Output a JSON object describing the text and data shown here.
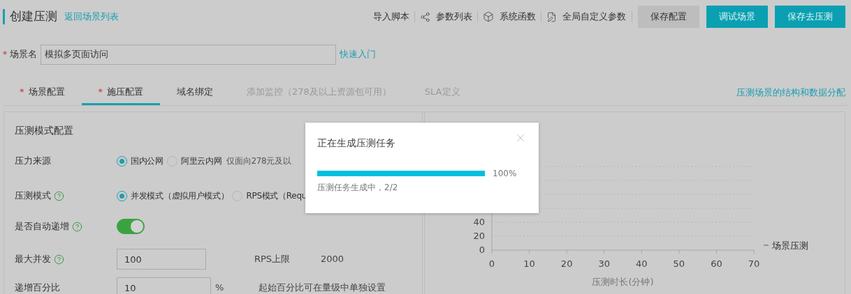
{
  "header": {
    "title": "创建压测",
    "back_link": "返回场景列表"
  },
  "toolbar": [
    {
      "label": "导入脚本"
    },
    {
      "label": "参数列表"
    },
    {
      "label": "系统函数"
    },
    {
      "label": "全局自定义参数"
    }
  ],
  "buttons": [
    {
      "label": "保存配置",
      "kind": "secondary"
    },
    {
      "label": "调试场景",
      "kind": "primary"
    },
    {
      "label": "保存去压测",
      "kind": "primary"
    }
  ],
  "scene_name": {
    "required_mark": "*",
    "label": "场景名",
    "value": "模拟多页面访问",
    "link": "快速入门"
  },
  "tabs": [
    {
      "required_mark": "*",
      "label": "场景配置",
      "selected": false,
      "disabled": false
    },
    {
      "required_mark": "*",
      "label": "施压配置",
      "selected": true,
      "disabled": false
    },
    {
      "label": "域名绑定",
      "selected": false,
      "disabled": false
    },
    {
      "label": "添加监控（278及以上资源包可用）",
      "selected": false,
      "disabled": true
    },
    {
      "label": "SLA定义",
      "selected": false,
      "disabled": true
    }
  ],
  "tabs_link": "压测场景的结构和数据分配",
  "config": {
    "title": "压测模式配置",
    "rows": [
      {
        "kind": "radio",
        "label": "压力来源",
        "help": false,
        "options": [
          {
            "label": "国内公网",
            "selected": true
          },
          {
            "label": "阿里云内网",
            "selected": false
          }
        ],
        "note": "仅面向278元及以"
      },
      {
        "kind": "radio",
        "label": "压测模式",
        "help": true,
        "options": [
          {
            "label": "并发模式（虚拟用户模式）",
            "selected": true
          },
          {
            "label": "RPS模式（Requ",
            "selected": false
          }
        ]
      },
      {
        "kind": "switch",
        "label": "是否自动递增",
        "help": true,
        "on": true
      },
      {
        "kind": "input",
        "label": "最大并发",
        "help": true,
        "value": "100",
        "extra_label": "RPS上限",
        "extra_value": "2000"
      },
      {
        "kind": "input",
        "label": "递增百分比",
        "help": false,
        "value": "10",
        "unit": "%",
        "note": "起始百分比可在量级中单独设置"
      }
    ]
  },
  "chart": {
    "chart_data": {
      "type": "line",
      "xlabel": "压测时长(分钟)",
      "categories": [
        "0",
        "10",
        "20",
        "30",
        "40",
        "50",
        "60",
        "70"
      ],
      "ylim": [
        0,
        120
      ],
      "yticks": [
        0,
        20,
        40
      ],
      "series": [
        {
          "name": "场景压测",
          "color": "#8a93b0",
          "values": [
            null,
            null,
            null,
            null,
            null,
            null,
            null,
            null
          ]
        }
      ]
    }
  },
  "dialog": {
    "title": "正在生成压测任务",
    "level": 1,
    "percent": "100%",
    "status": "压测任务生成中，2/2"
  }
}
